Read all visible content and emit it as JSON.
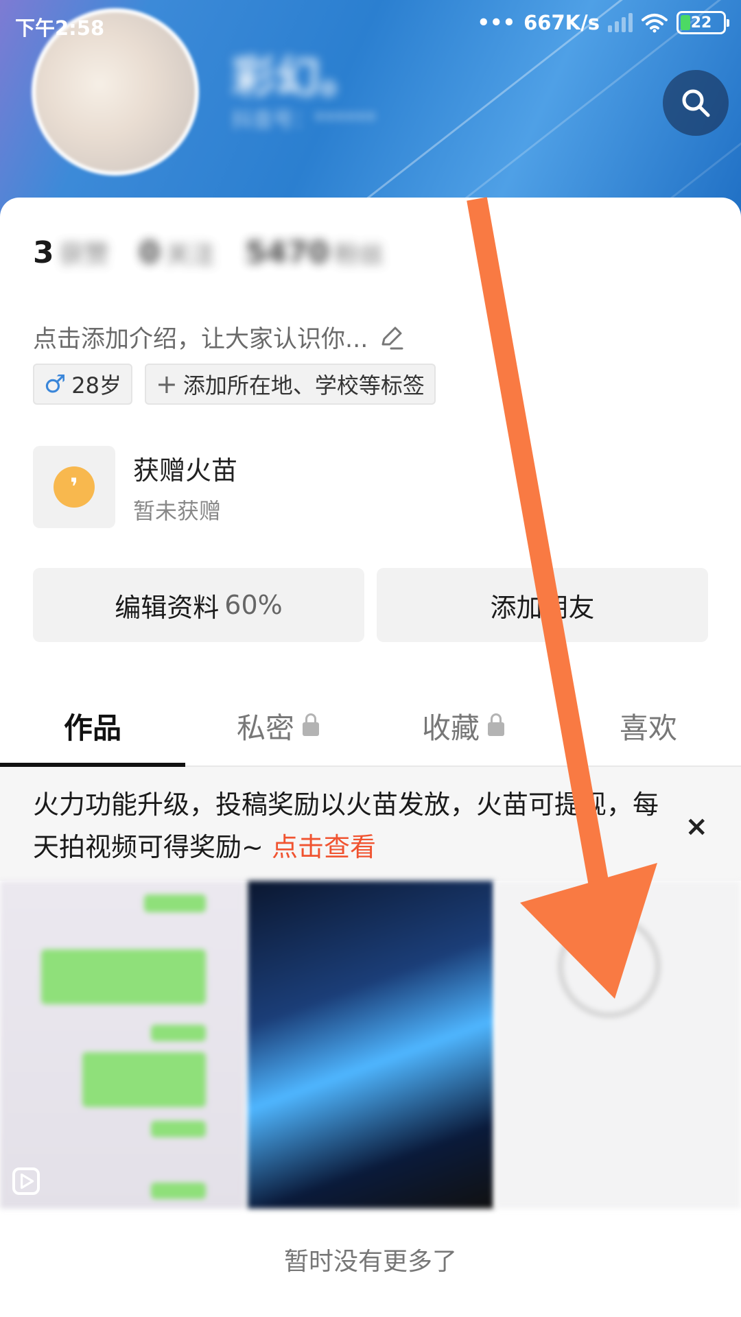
{
  "status_bar": {
    "time": "下午2:58",
    "network_speed": "667K/s",
    "battery": "22"
  },
  "profile": {
    "nickname": "彩幻。",
    "handle": "抖音号：******",
    "stats": [
      {
        "num": "3",
        "label": "获赞"
      },
      {
        "num": "0",
        "label": "关注"
      },
      {
        "num": "5470",
        "label": "粉丝"
      }
    ],
    "intro": "点击添加介绍，让大家认识你...",
    "tags": {
      "age": "28岁",
      "add": "添加所在地、学校等标签"
    },
    "fire": {
      "title": "获赠火苗",
      "subtitle": "暂未获赠"
    },
    "buttons": {
      "edit": "编辑资料",
      "edit_pct": "60%",
      "add_friend": "添加朋友"
    }
  },
  "tabs": [
    {
      "label": "作品"
    },
    {
      "label": "私密"
    },
    {
      "label": "收藏"
    },
    {
      "label": "喜欢"
    }
  ],
  "notice": {
    "text": "火力功能升级，投稿奖励以火苗发放，火苗可提现，每天拍视频可得奖励~",
    "link": "点击查看",
    "close": "×"
  },
  "footer": {
    "no_more": "暂时没有更多了"
  },
  "colors": {
    "annotation_arrow": "#f97a43",
    "link": "#f05330",
    "header": "#2b7fd0"
  },
  "icons": [
    "search-icon",
    "edit-pencil-icon",
    "male-icon",
    "plus-icon",
    "fire-coin-icon",
    "lock-icon",
    "close-icon",
    "play-icon",
    "wifi-icon",
    "signal-icon",
    "battery-icon"
  ]
}
